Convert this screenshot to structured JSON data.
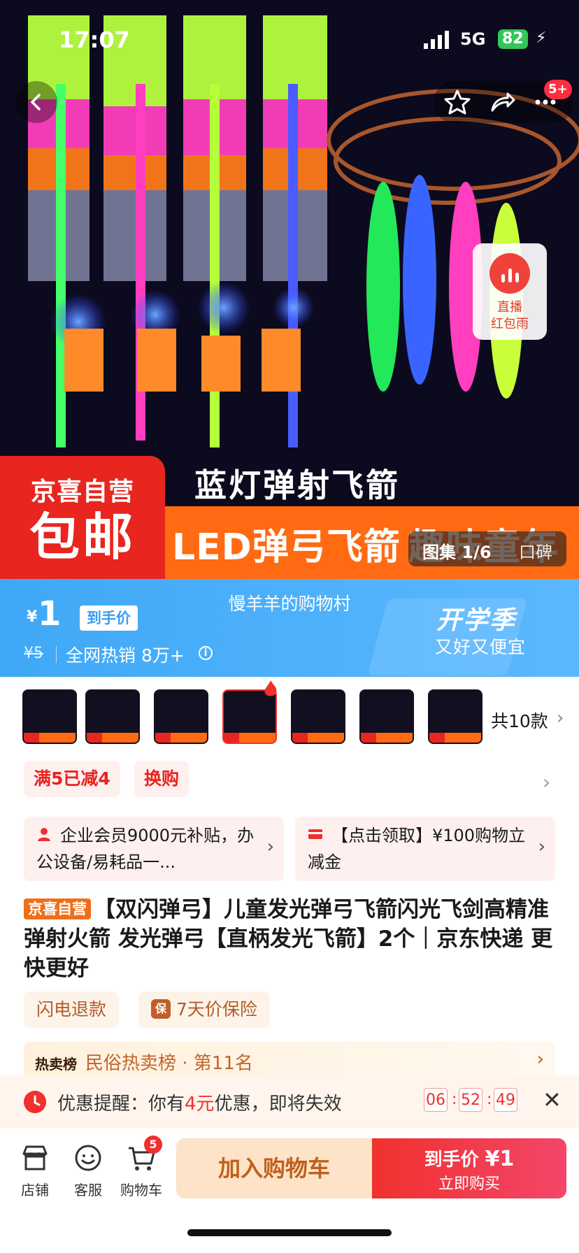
{
  "status_bar": {
    "time": "17:07",
    "network": "5G",
    "battery": "82"
  },
  "nav": {
    "message_badge": "5+"
  },
  "hero": {
    "live_label_1": "直播",
    "live_label_2": "红包雨",
    "banner_store_1": "京喜自营",
    "banner_store_2": "包邮",
    "banner_title": "蓝灯弹射飞箭",
    "banner_orange_1": "LED弹弓飞箭",
    "banner_orange_2": "趣味童年",
    "gallery_label": "图集 1/6",
    "review_label": "口碑"
  },
  "price_bar": {
    "currency": "¥",
    "price": "1",
    "price_tag": "到手价",
    "shop_name": "慢羊羊的购物村",
    "original_price": "¥5",
    "hot_text": "全网热销 8万+",
    "info_icon": "ⓘ",
    "season_title": "开学季",
    "season_sub": "又好又便宜"
  },
  "variants": {
    "count_label": "共10款"
  },
  "coupons": {
    "chip_1": "满5已减4",
    "chip_2": "换购"
  },
  "promos": {
    "left": "企业会员9000元补贴，办公设备/易耗品一...",
    "right": "【点击领取】¥100购物立减金"
  },
  "product": {
    "badge": "京喜自营",
    "title": "【双闪弹弓】儿童发光弹弓飞箭闪光飞剑高精准弹射火箭 发光弹弓【直柄发光飞箭】2个｜京东快递 更快更好"
  },
  "services": {
    "item_1": "闪电退款",
    "item_2_icon": "保",
    "item_2": "7天价保险"
  },
  "ranking": {
    "tag": "热卖榜",
    "text": "民俗热卖榜 · 第11名"
  },
  "reminder": {
    "prefix": "优惠提醒：你有",
    "amount": "4元",
    "suffix": "优惠，即将失效",
    "hh": "06",
    "mm": "52",
    "ss": "49"
  },
  "bottom_bar": {
    "store": "店铺",
    "service": "客服",
    "cart": "购物车",
    "cart_badge": "5",
    "add_to_cart": "加入购物车",
    "buy_price_label": "到手价",
    "buy_price": "¥1",
    "buy_now": "立即购买"
  },
  "colors": {
    "accent_red": "#f0302e",
    "price_blue": "#3fa8f6",
    "orange": "#ff6a12"
  }
}
